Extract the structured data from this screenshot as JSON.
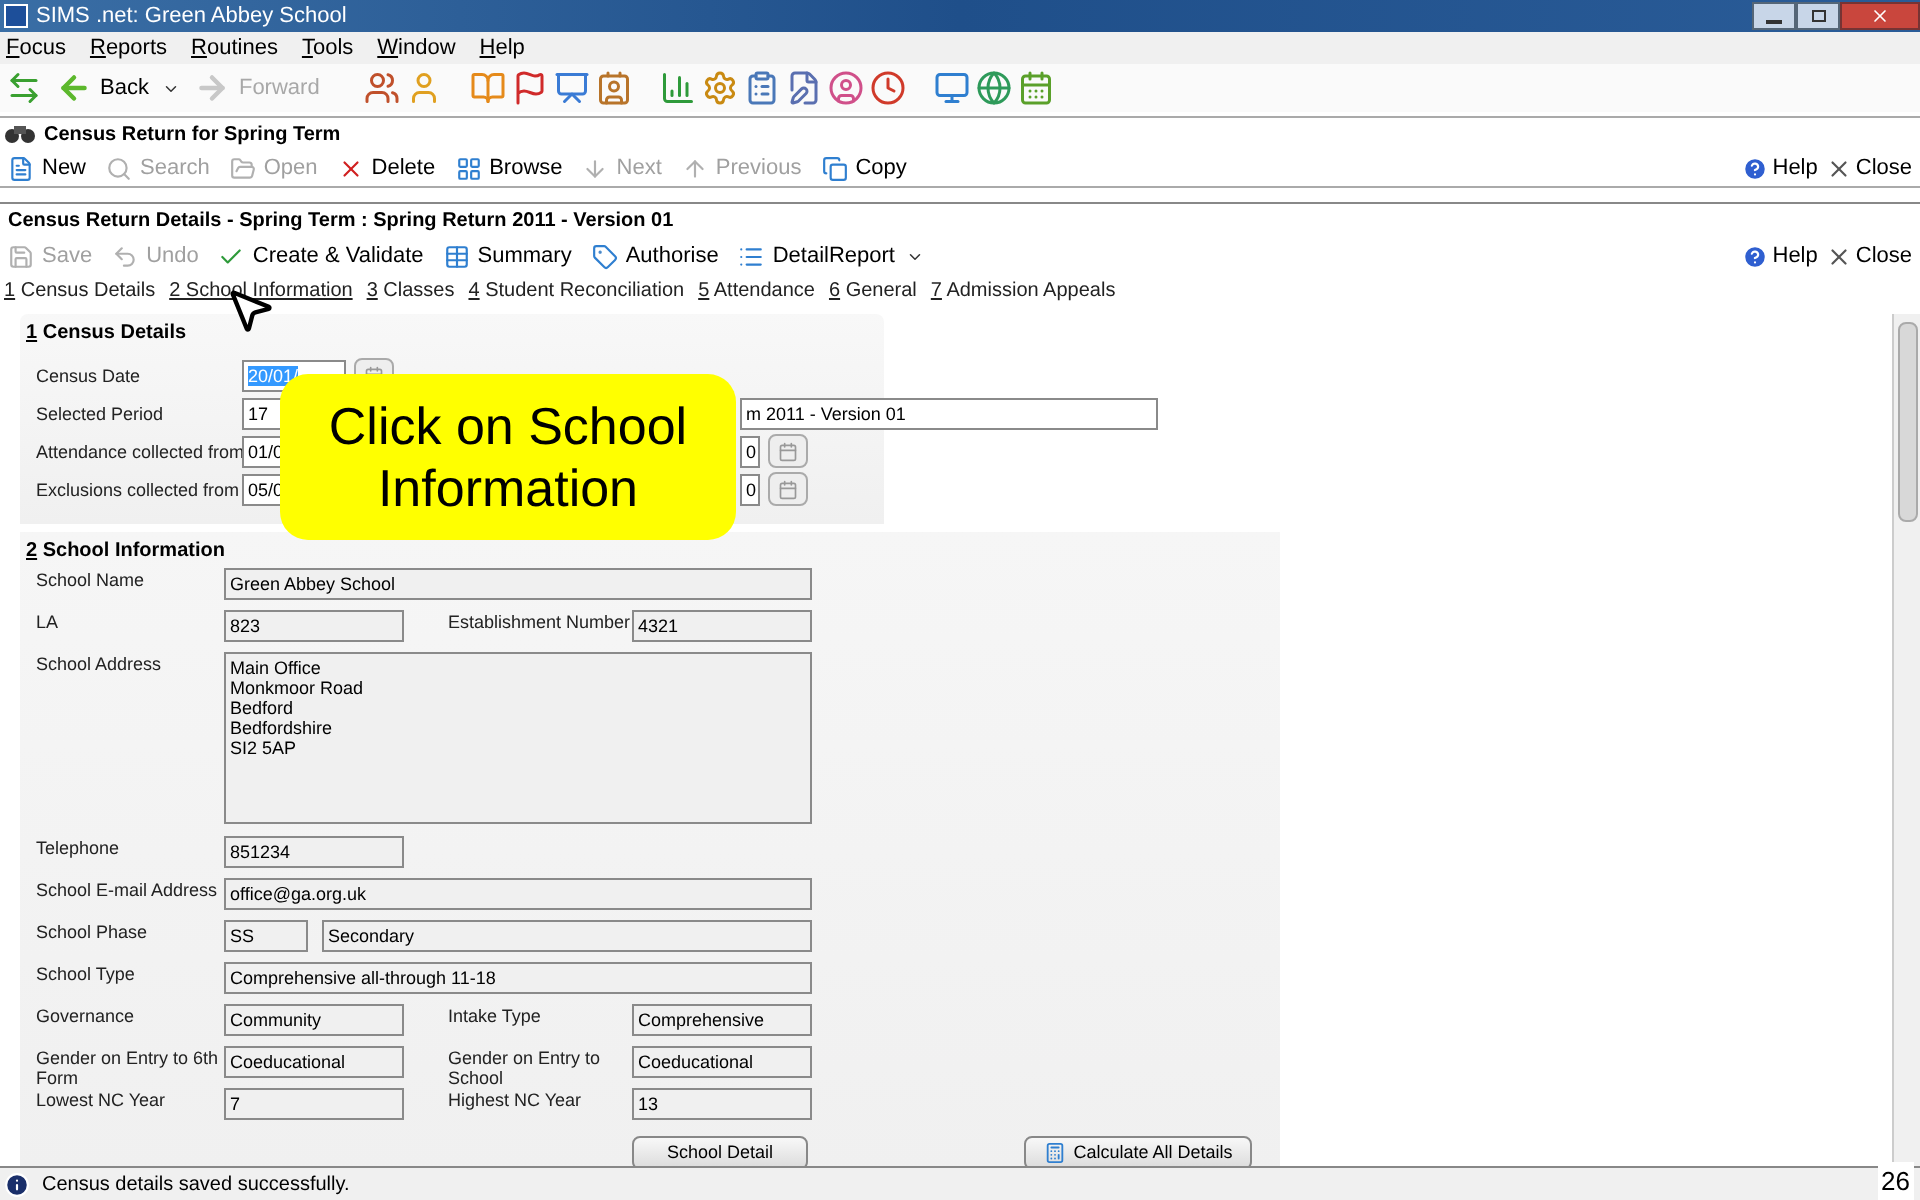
{
  "window": {
    "title": "SIMS .net: Green Abbey School"
  },
  "menu": [
    {
      "label": "Focus"
    },
    {
      "label": "Reports"
    },
    {
      "label": "Routines"
    },
    {
      "label": "Tools"
    },
    {
      "label": "Window"
    },
    {
      "label": "Help"
    }
  ],
  "nav": [
    {
      "label": "Back",
      "disabled": false
    },
    {
      "label": "Forward",
      "disabled": true
    }
  ],
  "module": {
    "title": "Census Return for Spring Term",
    "actions": [
      {
        "label": "New",
        "disabled": false
      },
      {
        "label": "Search",
        "disabled": true
      },
      {
        "label": "Open",
        "disabled": true
      },
      {
        "label": "Delete",
        "disabled": false
      },
      {
        "label": "Browse",
        "disabled": false
      },
      {
        "label": "Next",
        "disabled": true
      },
      {
        "label": "Previous",
        "disabled": true
      },
      {
        "label": "Copy",
        "disabled": false
      }
    ],
    "help": "Help",
    "close": "Close"
  },
  "details": {
    "title": "Census Return Details - Spring Term : Spring Return 2011 - Version 01",
    "actions": [
      {
        "label": "Save",
        "disabled": true
      },
      {
        "label": "Undo",
        "disabled": true
      },
      {
        "label": "Create & Validate",
        "disabled": false
      },
      {
        "label": "Summary",
        "disabled": false
      },
      {
        "label": "Authorise",
        "disabled": false
      },
      {
        "label": "DetailReport",
        "disabled": false
      }
    ],
    "help": "Help",
    "close": "Close",
    "tabs": [
      {
        "label": "1 Census Details",
        "hovered": false
      },
      {
        "label": "2 School Information",
        "hovered": true
      },
      {
        "label": "3 Classes",
        "hovered": false
      },
      {
        "label": "4 Student Reconciliation",
        "hovered": false
      },
      {
        "label": "5 Attendance",
        "hovered": false
      },
      {
        "label": "6 General",
        "hovered": false
      },
      {
        "label": "7 Admission Appeals",
        "hovered": false
      }
    ]
  },
  "census_details": {
    "heading": "1 Census Details",
    "rows": [
      {
        "kind": "date",
        "label": "Census Date",
        "value": "20/01/"
      },
      {
        "kind": "period",
        "label": "Selected Period",
        "value": "17",
        "extra": "m 2011 - Version 01"
      },
      {
        "kind": "range",
        "label": "Attendance collected from",
        "value": "01/0",
        "end_value": "0"
      },
      {
        "kind": "range",
        "label": "Exclusions collected from",
        "value": "05/0",
        "end_value": "0"
      }
    ]
  },
  "school_information": {
    "heading": "2 School Information",
    "rows": [
      {
        "kind": "wide",
        "label": "School Name",
        "value": "Green Abbey School"
      },
      {
        "kind": "pair",
        "items": [
          {
            "label": "LA",
            "value": "823"
          },
          {
            "label": "Establishment Number",
            "value": "4321"
          }
        ]
      },
      {
        "kind": "address",
        "label": "School Address",
        "lines": [
          "Main Office",
          "Monkmoor Road",
          "Bedford",
          "Bedfordshire",
          "SI2 5AP"
        ]
      },
      {
        "kind": "short",
        "label": "Telephone",
        "value": "851234"
      },
      {
        "kind": "wide",
        "label": "School E-mail Address",
        "value": "office@ga.org.uk"
      },
      {
        "kind": "code",
        "label": "School Phase",
        "code": "SS",
        "value": "Secondary"
      },
      {
        "kind": "wide",
        "label": "School Type",
        "value": "Comprehensive all-through 11-18"
      },
      {
        "kind": "pair",
        "items": [
          {
            "label": "Governance",
            "value": "Community"
          },
          {
            "label": "Intake Type",
            "value": "Comprehensive"
          }
        ]
      },
      {
        "kind": "pair",
        "items": [
          {
            "label": "Gender on Entry to 6th Form",
            "value": "Coeducational"
          },
          {
            "label": "Gender on Entry to School",
            "value": "Coeducational"
          }
        ]
      },
      {
        "kind": "pair",
        "items": [
          {
            "label": "Lowest NC Year",
            "value": "7"
          },
          {
            "label": "Highest NC Year",
            "value": "13"
          }
        ]
      }
    ],
    "buttons": [
      "School Detail",
      "Calculate All Details"
    ]
  },
  "status_bar": {
    "message": "Census details saved successfully."
  },
  "callout": "Click on School Information",
  "slide_number": "26"
}
